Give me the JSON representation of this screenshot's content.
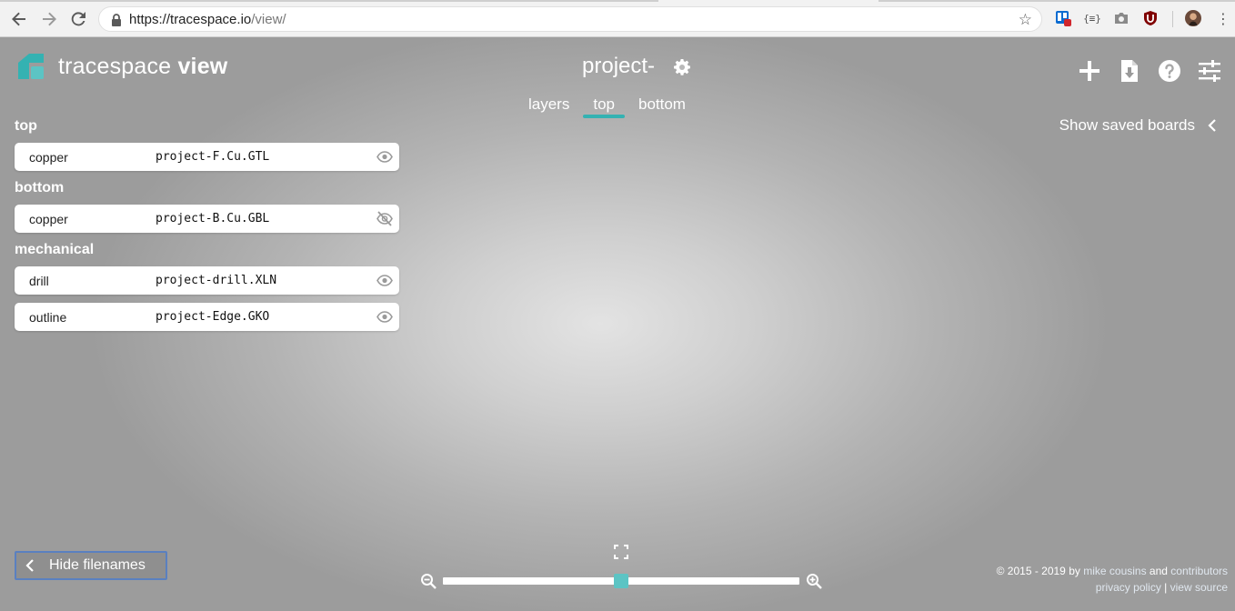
{
  "browser": {
    "url_host": "https://tracespace.io",
    "url_path": "/view/",
    "ext_badge": "E"
  },
  "app": {
    "brand_light": "tracespace",
    "brand_bold": "view",
    "project_name": "project-",
    "tabs": [
      {
        "label": "layers"
      },
      {
        "label": "top"
      },
      {
        "label": "bottom"
      }
    ],
    "active_tab": "top",
    "show_saved_label": "Show saved boards",
    "accent_color": "#34b2b2"
  },
  "layers": {
    "groups": [
      {
        "title": "top",
        "items": [
          {
            "type": "copper",
            "filename": "project-F.Cu.GTL",
            "visible": true
          }
        ]
      },
      {
        "title": "bottom",
        "items": [
          {
            "type": "copper",
            "filename": "project-B.Cu.GBL",
            "visible": false
          }
        ]
      },
      {
        "title": "mechanical",
        "items": [
          {
            "type": "drill",
            "filename": "project-drill.XLN",
            "visible": true
          },
          {
            "type": "outline",
            "filename": "project-Edge.GKO",
            "visible": true
          }
        ]
      }
    ]
  },
  "controls": {
    "hide_filenames_label": "Hide filenames",
    "zoom_level": 0.5
  },
  "footer": {
    "copyright": "© 2015 - 2019 by",
    "author": "mike cousins",
    "and": "and",
    "contributors": "contributors",
    "privacy": "privacy policy",
    "separator": "|",
    "source": "view source"
  }
}
